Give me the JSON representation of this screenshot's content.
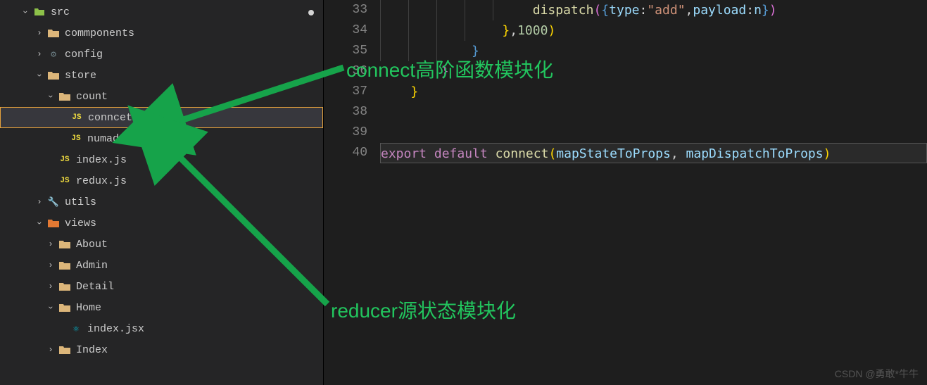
{
  "tree": {
    "src": "src",
    "commponents": "commponents",
    "config": "config",
    "store": "store",
    "count": "count",
    "conncet": "conncet.js",
    "numadd": "numadd.js",
    "indexjs": "index.js",
    "reduxjs": "redux.js",
    "utils": "utils",
    "views": "views",
    "about": "About",
    "admin": "Admin",
    "detail": "Detail",
    "home": "Home",
    "indexjsx": "index.jsx",
    "indexfolder": "Index"
  },
  "lineNumbers": [
    "33",
    "34",
    "35",
    "36",
    "37",
    "38",
    "39",
    "40"
  ],
  "code": {
    "l33": {
      "a": "dispatch",
      "b": "type",
      "c": "\"add\"",
      "d": "payload",
      "e": "n"
    },
    "l34": {
      "a": "1000"
    },
    "l40": {
      "a": "export",
      "b": "default",
      "c": "connect",
      "d": "mapStateToProps",
      "e": "mapDispatchToProps"
    }
  },
  "annotations": {
    "top": "connect高阶函数模块化",
    "bottom": "reducer源状态模块化"
  },
  "watermark": "CSDN @勇敢*牛牛"
}
